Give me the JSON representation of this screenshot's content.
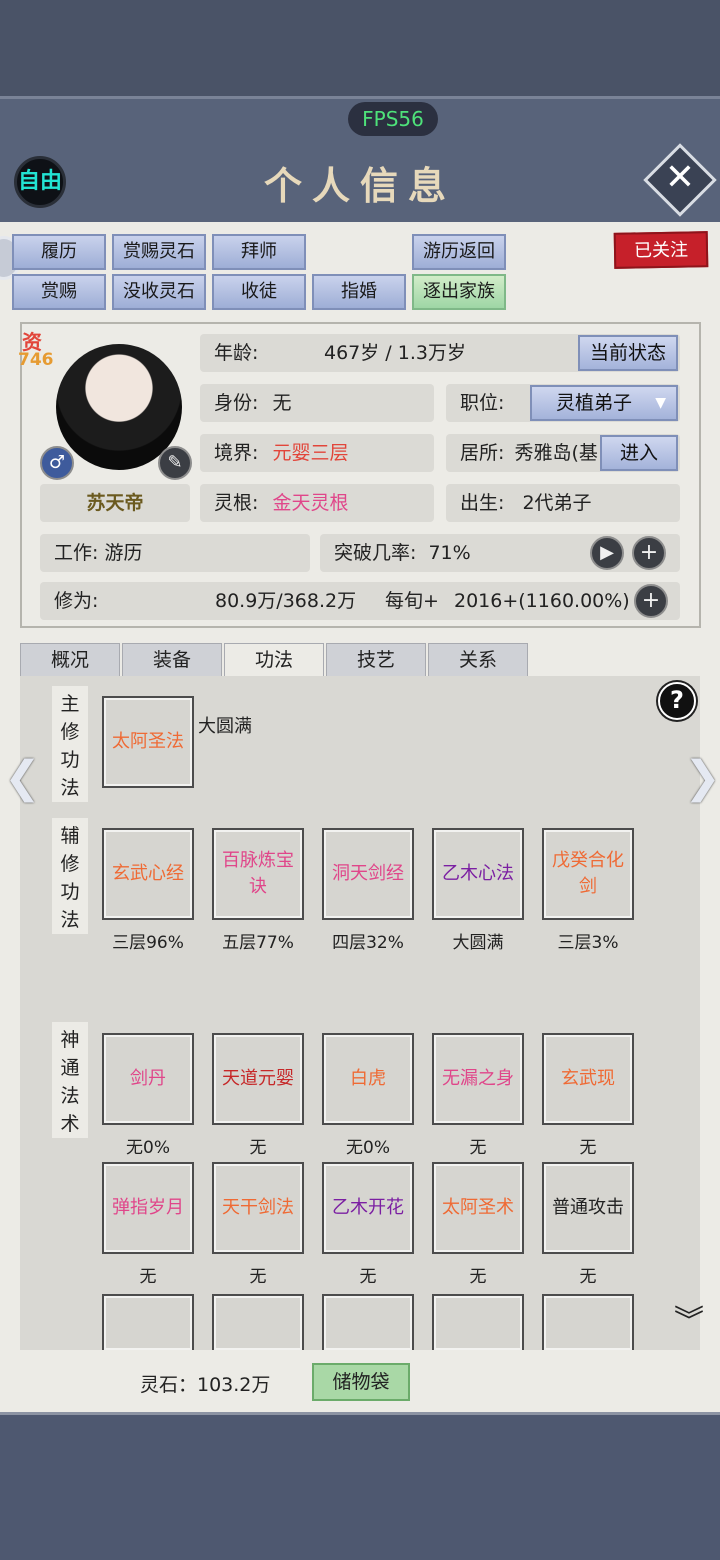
{
  "fps": "FPS56",
  "header": {
    "free_label": "自由",
    "title": "个人信息"
  },
  "actions": {
    "row1": [
      "履历",
      "赏赐灵石",
      "拜师",
      "游历返回"
    ],
    "row2": [
      "赏赐",
      "没收灵石",
      "收徒",
      "指婚",
      "逐出家族"
    ],
    "follow": "已关注"
  },
  "profile": {
    "aptitude_label": "资",
    "aptitude_value": "746",
    "name": "苏天帝",
    "age_label": "年龄:",
    "age_value": "467岁 / 1.3万岁",
    "status_button": "当前状态",
    "identity_label": "身份:",
    "identity_value": "无",
    "position_label": "职位:",
    "position_value": "灵植弟子",
    "realm_label": "境界:",
    "realm_value": "元婴三层",
    "residence_label": "居所:",
    "residence_value": "秀雅岛(基",
    "enter_button": "进入",
    "root_label": "灵根:",
    "root_value": "金天灵根",
    "birth_label": "出生:",
    "birth_value": "2代弟子",
    "work_label": "工作:",
    "work_value": "游历",
    "breakthrough_label": "突破几率:",
    "breakthrough_value": "71%",
    "cultivation_label": "修为:",
    "cultivation_value": "80.9万/368.2万",
    "per_turn_label": "每旬+",
    "per_turn_value": "2016+(1160.00%)"
  },
  "tabs": [
    "概况",
    "装备",
    "功法",
    "技艺",
    "关系"
  ],
  "skills": {
    "main_label": "主修功法",
    "main": {
      "name": "太阿圣法",
      "level": "大圆满"
    },
    "aux_label": "辅修功法",
    "aux": [
      {
        "name": "玄武心经",
        "level": "三层96%",
        "color": "#ef6a34"
      },
      {
        "name": "百脉炼宝诀",
        "level": "五层77%",
        "color": "#e0468a"
      },
      {
        "name": "洞天剑经",
        "level": "四层32%",
        "color": "#e0468a"
      },
      {
        "name": "乙木心法",
        "level": "大圆满",
        "color": "#7b1fa2"
      },
      {
        "name": "戊癸合化剑",
        "level": "三层3%",
        "color": "#ef6a34"
      }
    ],
    "magic_label": "神通法术",
    "magic": [
      {
        "name": "剑丹",
        "level": "无0%",
        "color": "#e0468a"
      },
      {
        "name": "天道元婴",
        "level": "无",
        "color": "#c62828"
      },
      {
        "name": "白虎",
        "level": "无0%",
        "color": "#ef6a34"
      },
      {
        "name": "无漏之身",
        "level": "无",
        "color": "#e0468a"
      },
      {
        "name": "玄武现",
        "level": "无",
        "color": "#ef6a34"
      },
      {
        "name": "弹指岁月",
        "level": "无",
        "color": "#e0468a"
      },
      {
        "name": "天干剑法",
        "level": "无",
        "color": "#ef6a34"
      },
      {
        "name": "乙木开花",
        "level": "无",
        "color": "#7b1fa2"
      },
      {
        "name": "太阿圣术",
        "level": "无",
        "color": "#ef6a34"
      },
      {
        "name": "普通攻击",
        "level": "无",
        "color": "#222222"
      }
    ]
  },
  "footer": {
    "spirit_stone": "灵石：103.2万",
    "bag_button": "储物袋"
  }
}
